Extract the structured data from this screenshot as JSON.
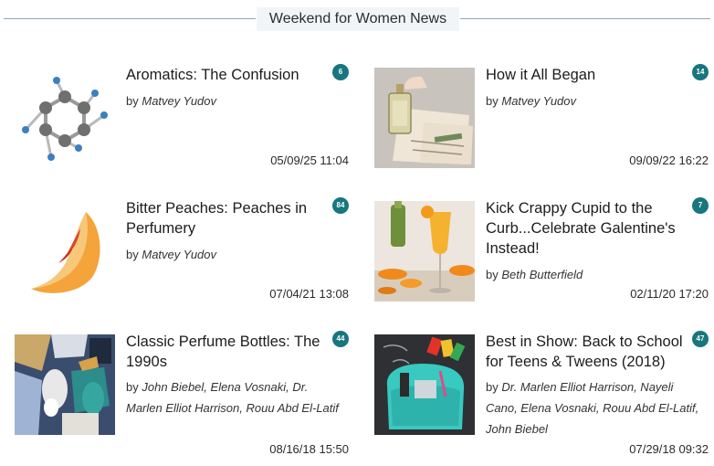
{
  "section": {
    "title": "Weekend for Women News"
  },
  "articles": [
    {
      "headline": "Aromatics: The Confusion",
      "comments": "6",
      "by": "by",
      "authors": "Matvey Yudov",
      "date": "05/09/25 11:04",
      "thumb_icon": "benzene-molecule"
    },
    {
      "headline": "How it All Began",
      "comments": "14",
      "by": "by",
      "authors": "Matvey Yudov",
      "date": "09/09/22 16:22",
      "thumb_icon": "perfume-bottle-letters"
    },
    {
      "headline": "Bitter Peaches: Peaches in Perfumery",
      "comments": "84",
      "by": "by",
      "authors": "Matvey Yudov",
      "date": "07/04/21 13:08",
      "thumb_icon": "peach-slice"
    },
    {
      "headline": "Kick Crappy Cupid to the Curb...Celebrate Galentine's Instead!",
      "comments": "7",
      "by": "by",
      "authors": "Beth Butterfield",
      "date": "02/11/20 17:20",
      "thumb_icon": "mimosa-glass-oranges"
    },
    {
      "headline": "Classic Perfume Bottles: The 1990s",
      "comments": "44",
      "by": "by",
      "authors": "John Biebel, Elena Vosnaki, Dr. Marlen Elliot Harrison, Rouu Abd El-Latif",
      "date": "08/16/18 15:50",
      "thumb_icon": "perfume-bottles-collage"
    },
    {
      "headline": "Best in Show: Back to School for Teens & Tweens (2018)",
      "comments": "47",
      "by": "by",
      "authors": "Dr. Marlen Elliot Harrison, Nayeli Cano, Elena Vosnaki, Rouu Abd El-Latif, John Biebel",
      "date": "07/29/18 09:32",
      "thumb_icon": "backpack-chalkboard"
    }
  ],
  "colors": {
    "badge": "#17767e",
    "rule": "#8fa4b6",
    "header_bg": "#f2f5f8"
  }
}
